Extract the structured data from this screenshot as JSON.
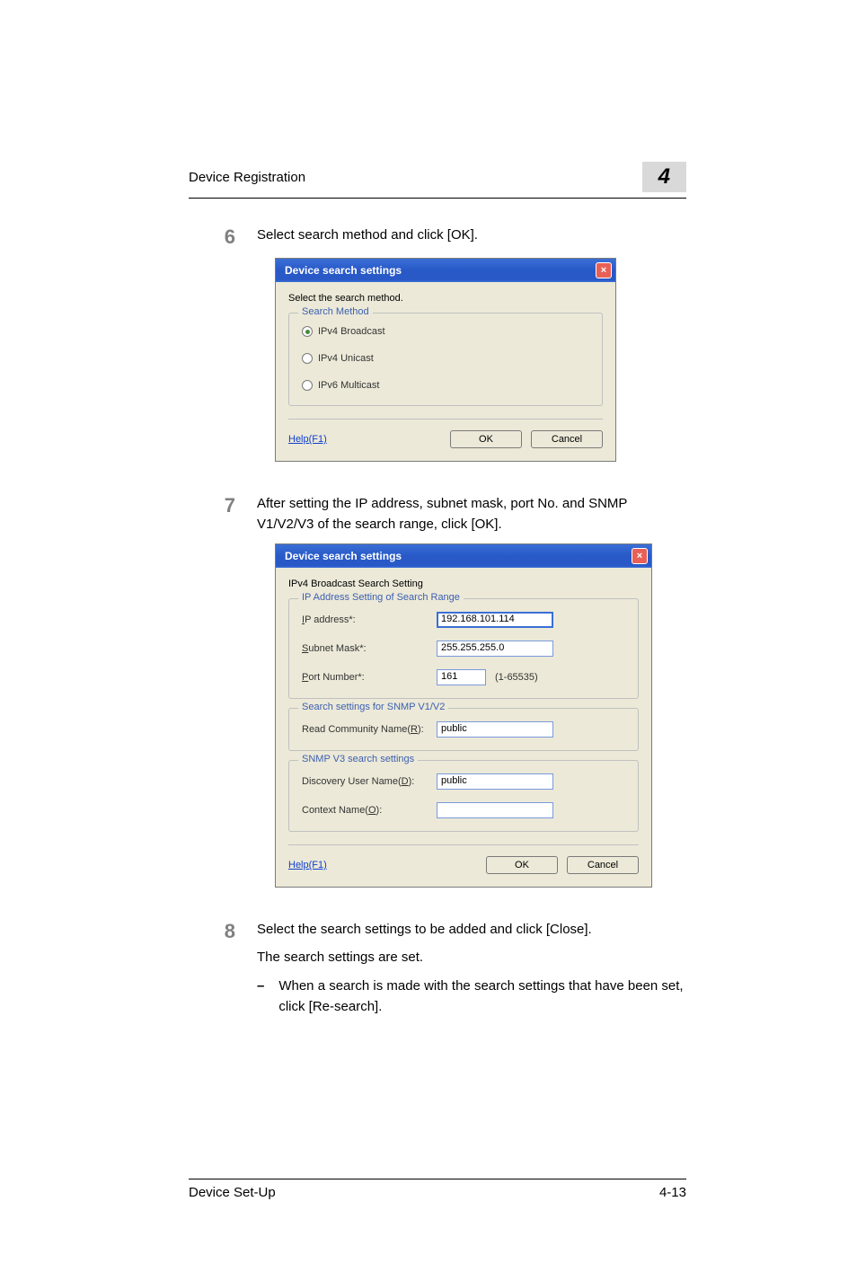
{
  "header": {
    "left": "Device Registration",
    "chapter": "4"
  },
  "step6": {
    "num": "6",
    "text": "Select search method and click [OK]."
  },
  "dialog1": {
    "title": "Device search settings",
    "instruction": "Select the search method.",
    "legend": "Search Method",
    "radios": {
      "r1": "IPv4 Broadcast",
      "r2": "IPv4 Unicast",
      "r3": "IPv6 Multicast"
    },
    "help": "Help(F1)",
    "ok": "OK",
    "cancel": "Cancel"
  },
  "step7": {
    "num": "7",
    "text": "After setting the IP address, subnet mask, port No. and SNMP V1/V2/V3 of the search range, click [OK]."
  },
  "dialog2": {
    "title": "Device search settings",
    "section": "IPv4 Broadcast Search Setting",
    "fs1": {
      "legend": "IP Address Setting of Search Range",
      "ip_label": "IP address*:",
      "ip_value": "192.168.101.114",
      "subnet_label": "Subnet Mask*:",
      "subnet_value": "255.255.255.0",
      "port_label": "Port Number*:",
      "port_value": "161",
      "port_hint": "(1-65535)"
    },
    "fs2": {
      "legend": "Search settings for SNMP V1/V2",
      "read_label": "Read Community Name(R):",
      "read_value": "public"
    },
    "fs3": {
      "legend": "SNMP V3 search settings",
      "disc_label": "Discovery User Name(D):",
      "disc_value": "public",
      "ctx_label": "Context Name(O):",
      "ctx_value": ""
    },
    "help": "Help(F1)",
    "ok": "OK",
    "cancel": "Cancel"
  },
  "step8": {
    "num": "8",
    "text1": "Select the search settings to be added and click [Close].",
    "text2": "The search settings are set.",
    "bullet": "When a search is made with the search settings that have been set, click [Re-search]."
  },
  "footer": {
    "left": "Device Set-Up",
    "right": "4-13"
  }
}
